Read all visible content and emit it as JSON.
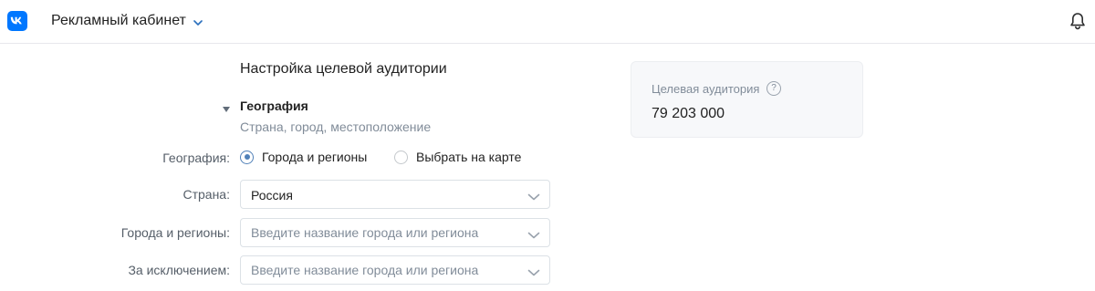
{
  "header": {
    "logo_text": "VK",
    "cabinet_title": "Рекламный кабинет",
    "icons": {
      "logo": "vk-logo-icon",
      "menu": "chevron-down-icon",
      "notifications": "bell-icon"
    },
    "colors": {
      "brand": "#0077ff",
      "accent": "#5181b8"
    }
  },
  "main": {
    "section_title": "Настройка целевой аудитории",
    "geography": {
      "title": "География",
      "subtitle": "Страна, город, местоположение",
      "expanded": true,
      "mode_label": "География:",
      "mode_options": [
        {
          "label": "Города и регионы",
          "selected": true
        },
        {
          "label": "Выбрать на карте",
          "selected": false
        }
      ],
      "country": {
        "label": "Страна:",
        "value": "Россия"
      },
      "cities": {
        "label": "Города и регионы:",
        "placeholder": "Введите название города или региона",
        "value": ""
      },
      "exclusions": {
        "label": "За исключением:",
        "placeholder": "Введите название города или региона",
        "value": ""
      }
    }
  },
  "audience": {
    "label": "Целевая аудитория",
    "help": "?",
    "value": "79 203 000"
  }
}
